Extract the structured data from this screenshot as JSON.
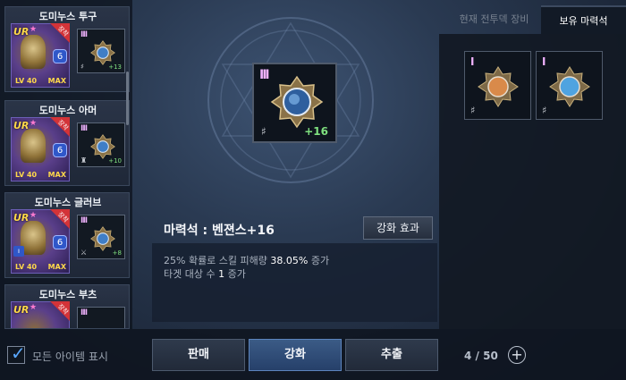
{
  "equipment": [
    {
      "name": "도미누스 투구",
      "ur": "UR",
      "badge": "장착",
      "level": "LV 40",
      "max": "MAX",
      "stone_tier": "III",
      "stone_plus": "+13"
    },
    {
      "name": "도미누스 아머",
      "ur": "UR",
      "badge": "장착",
      "level": "LV 40",
      "max": "MAX",
      "stone_tier": "III",
      "stone_plus": "+10"
    },
    {
      "name": "도미누스 글러브",
      "ur": "UR",
      "badge": "장착",
      "level": "LV 40",
      "max": "MAX",
      "stone_tier": "III",
      "stone_plus": "+8"
    },
    {
      "name": "도미누스 부츠",
      "ur": "UR",
      "badge": "장착",
      "level": "",
      "max": "",
      "stone_tier": "III",
      "stone_plus": ""
    }
  ],
  "selected_stone": {
    "tier": "III",
    "plus": "+16",
    "title": "마력석 : 벤젼스+16",
    "effect_button": "강화 효과",
    "description": [
      {
        "before": "25% 확률로 스킬 피해량 ",
        "highlight": "38.05%",
        "after": " 증가"
      },
      {
        "before": "타겟 대상 수 ",
        "highlight": "1",
        "after": " 증가"
      }
    ]
  },
  "tabs": {
    "current": "현재 전투덱 장비",
    "owned": "보유 마력석"
  },
  "owned_stones": [
    {
      "tier": "I",
      "gem_color": "#d98a4a"
    },
    {
      "tier": "I",
      "gem_color": "#4fa3e0"
    }
  ],
  "bottom": {
    "show_all_label": "모든 아이템 표시",
    "show_all_checked": true,
    "sell": "판매",
    "enhance": "강화",
    "extract": "추출",
    "count": "4 / 50"
  },
  "colors": {
    "tier": "#f0b2ff",
    "plus": "#7fe07f",
    "accent": "#5aa8ff",
    "legendary_gold": "#ffd84a",
    "equipped_ribbon": "#d33338"
  },
  "icons": [
    "gem-icon",
    "broken-chain-icon",
    "lock-icon",
    "check-icon",
    "plus-circle-icon"
  ]
}
